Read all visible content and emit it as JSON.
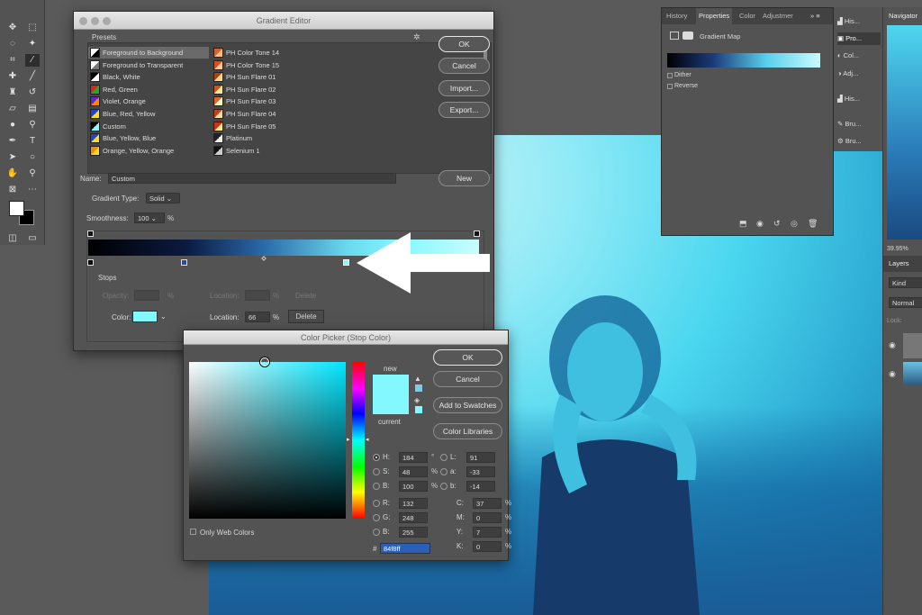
{
  "gradient_editor": {
    "title": "Gradient Editor",
    "presets_label": "Presets",
    "presets_left": [
      {
        "label": "Foreground to Background",
        "c1": "#ffffff",
        "c2": "#000000"
      },
      {
        "label": "Foreground to Transparent",
        "c1": "#ffffff",
        "c2": "#777777"
      },
      {
        "label": "Black, White",
        "c1": "#000000",
        "c2": "#ffffff"
      },
      {
        "label": "Red, Green",
        "c1": "#d22",
        "c2": "#2a2"
      },
      {
        "label": "Violet, Orange",
        "c1": "#62c",
        "c2": "#f80"
      },
      {
        "label": "Blue, Red, Yellow",
        "c1": "#24c",
        "c2": "#fd2"
      },
      {
        "label": "Custom",
        "c1": "#000",
        "c2": "#84f8ff"
      },
      {
        "label": "Blue, Yellow, Blue",
        "c1": "#24c",
        "c2": "#fd2"
      },
      {
        "label": "Orange, Yellow, Orange",
        "c1": "#f80",
        "c2": "#fd2"
      }
    ],
    "presets_right": [
      {
        "label": "PH Color Tone 14",
        "c1": "#c63",
        "c2": "#fb8"
      },
      {
        "label": "PH Color Tone 15",
        "c1": "#c52",
        "c2": "#fc9"
      },
      {
        "label": "PH Sun Flare 01",
        "c1": "#a41",
        "c2": "#fd8"
      },
      {
        "label": "PH Sun Flare 02",
        "c1": "#c52",
        "c2": "#fe9"
      },
      {
        "label": "PH Sun Flare 03",
        "c1": "#d63",
        "c2": "#ffc"
      },
      {
        "label": "PH Sun Flare 04",
        "c1": "#b42",
        "c2": "#fda"
      },
      {
        "label": "PH Sun Flare 05",
        "c1": "#c31",
        "c2": "#fe8"
      },
      {
        "label": "Platinum",
        "c1": "#222",
        "c2": "#eee"
      },
      {
        "label": "Selenium 1",
        "c1": "#111",
        "c2": "#ccc"
      }
    ],
    "buttons": {
      "ok": "OK",
      "cancel": "Cancel",
      "import": "Import...",
      "export": "Export...",
      "new": "New"
    },
    "name_label": "Name:",
    "name_value": "Custom",
    "gradient_type_label": "Gradient Type:",
    "gradient_type_value": "Solid",
    "smoothness_label": "Smoothness:",
    "smoothness_value": "100",
    "smoothness_unit": "%",
    "stops_label": "Stops",
    "opacity_label": "Opacity:",
    "opacity_unit": "%",
    "location_label": "Location:",
    "location_unit": "%",
    "delete_label": "Delete",
    "color_label": "Color:",
    "stop_color": "#84f8ff",
    "location_value": "66"
  },
  "color_picker": {
    "title": "Color Picker (Stop Color)",
    "ok": "OK",
    "cancel": "Cancel",
    "add_to_swatches": "Add to Swatches",
    "color_libraries": "Color Libraries",
    "new_label": "new",
    "current_label": "current",
    "new_color": "#84f8ff",
    "current_color": "#84f8ff",
    "only_web_colors": "Only Web Colors",
    "hsb": [
      {
        "k": "H:",
        "v": "184",
        "u": "°"
      },
      {
        "k": "S:",
        "v": "48",
        "u": "%"
      },
      {
        "k": "B:",
        "v": "100",
        "u": "%"
      }
    ],
    "rgb": [
      {
        "k": "R:",
        "v": "132"
      },
      {
        "k": "G:",
        "v": "248"
      },
      {
        "k": "B:",
        "v": "255"
      }
    ],
    "lab": [
      {
        "k": "L:",
        "v": "91"
      },
      {
        "k": "a:",
        "v": "-33"
      },
      {
        "k": "b:",
        "v": "-14"
      }
    ],
    "cmyk": [
      {
        "k": "C:",
        "v": "37",
        "u": "%"
      },
      {
        "k": "M:",
        "v": "0",
        "u": "%"
      },
      {
        "k": "Y:",
        "v": "7",
        "u": "%"
      },
      {
        "k": "K:",
        "v": "0",
        "u": "%"
      }
    ],
    "hex_label": "#",
    "hex_value": "84f8ff"
  },
  "properties_panel": {
    "tabs": [
      "History",
      "Properties",
      "Color",
      "Adjustmer"
    ],
    "adjustment_title": "Gradient Map",
    "dither": "Dither",
    "reverse": "Reverse"
  },
  "right_panel_items": [
    "His...",
    "Pro...",
    "Col...",
    "Adj...",
    "His...",
    "Bru...",
    "Bru..."
  ],
  "navigator": {
    "title": "Navigator",
    "zoom": "39.95%",
    "layers_tab": "Layers",
    "kind": "Kind",
    "blend": "Normal",
    "lock": "Lock:"
  },
  "toolbar_icons": [
    "move-icon",
    "marquee-icon",
    "lasso-icon",
    "magic-wand-icon",
    "crop-icon",
    "eyedropper-icon",
    "healing-icon",
    "brush-icon",
    "stamp-icon",
    "history-brush-icon",
    "eraser-icon",
    "gradient-icon",
    "blur-icon",
    "dodge-icon",
    "pen-icon",
    "type-icon",
    "path-select-icon",
    "shape-icon",
    "hand-icon",
    "zoom-icon",
    "frame-icon",
    "more-icon"
  ]
}
